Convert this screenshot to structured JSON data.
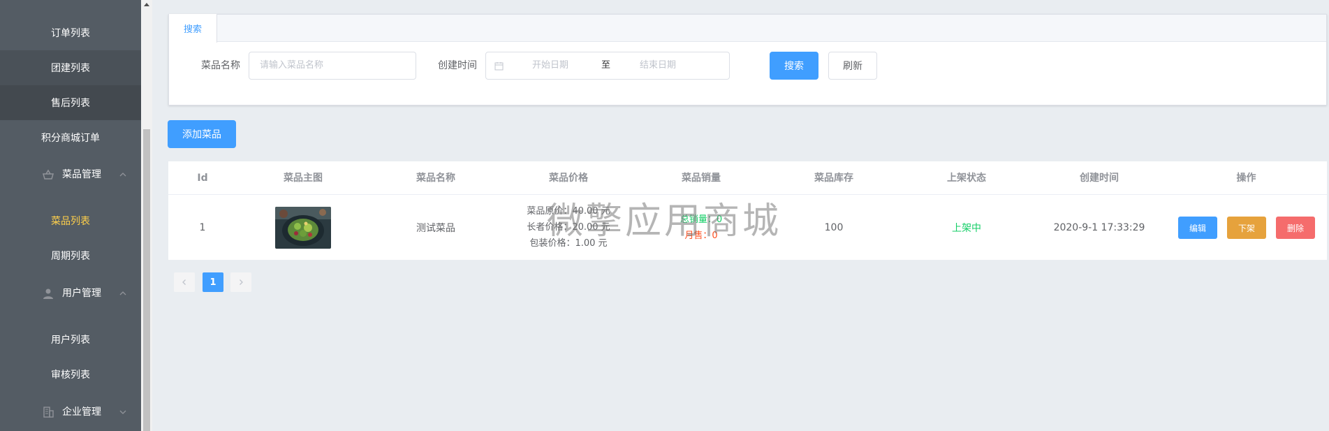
{
  "sidebar": {
    "items": [
      {
        "label": "订单列表"
      },
      {
        "label": "团建列表"
      },
      {
        "label": "售后列表"
      },
      {
        "label": "积分商城订单"
      },
      {
        "label": "菜品列表"
      },
      {
        "label": "周期列表"
      },
      {
        "label": "用户列表"
      },
      {
        "label": "审核列表"
      }
    ],
    "groups": [
      {
        "label": "菜品管理",
        "icon": "food-basket-icon"
      },
      {
        "label": "用户管理",
        "icon": "user-icon"
      },
      {
        "label": "企业管理",
        "icon": "building-icon"
      }
    ],
    "active_color": "#ffd04b",
    "background": "#545c64"
  },
  "search": {
    "tab_label": "搜索",
    "name_label": "菜品名称",
    "name_placeholder": "请输入菜品名称",
    "time_label": "创建时间",
    "start_placeholder": "开始日期",
    "range_separator": "至",
    "end_placeholder": "结束日期",
    "search_button": "搜索",
    "refresh_button": "刷新"
  },
  "add_button": "添加菜品",
  "table": {
    "headers": [
      "Id",
      "菜品主图",
      "菜品名称",
      "菜品价格",
      "菜品销量",
      "菜品库存",
      "上架状态",
      "创建时间",
      "操作"
    ],
    "rows": [
      {
        "id": "1",
        "name": "测试菜品",
        "price_original": "菜品原价：40.00 元",
        "price_elder": "长者价格：20.00 元",
        "price_package": "包装价格：1.00 元",
        "sales_total": "总销量：0",
        "sales_month": "月售：0",
        "stock": "100",
        "status": "上架中",
        "created": "2020-9-1 17:33:29",
        "actions": {
          "edit": "编辑",
          "offshelf": "下架",
          "delete": "删除"
        }
      }
    ]
  },
  "watermark": "微擎应用商城",
  "pagination": {
    "current": "1"
  },
  "colors": {
    "primary": "#409eff",
    "warning": "#e6a23c",
    "danger": "#f56c6c",
    "success": "#13ce66"
  }
}
